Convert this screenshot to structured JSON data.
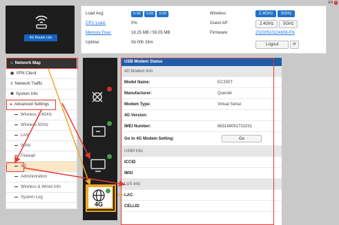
{
  "logo": {
    "text": "4G Router Lite"
  },
  "header": {
    "load_avg_label": "Load Avg:",
    "load_avg_values": [
      "0.00",
      "0.00",
      "0.00"
    ],
    "cpu_label": "CPU Load:",
    "cpu_value": "0%",
    "memory_label": "Memory Free:",
    "memory_value": "18.25 MB / 59.05 MB",
    "uptime_label": "Uptime:",
    "uptime_value": "0d 00h 26m",
    "wireless_label": "Wireless:",
    "wireless_24": "2.4GHz",
    "wireless_5": "5GHz",
    "guest_label": "Guest AP:",
    "guest_24": "2.4GHz",
    "guest_5": "5GHz",
    "firmware_label": "Firmware:",
    "firmware_value": "20230510224636-FN",
    "logout_label": "Logout",
    "lang_text": "EN"
  },
  "sidebar": {
    "items": [
      {
        "label": "Network Map"
      },
      {
        "label": "VPN Client"
      },
      {
        "label": "Network Traffic"
      },
      {
        "label": "System Info"
      },
      {
        "label": "Advanced Settings"
      },
      {
        "label": "Wireless 2.4GHz"
      },
      {
        "label": "Wireless 5GHz"
      },
      {
        "label": "LAN"
      },
      {
        "label": "WAN"
      },
      {
        "label": "Firewall"
      },
      {
        "label": "4G"
      },
      {
        "label": "Administration"
      },
      {
        "label": "Wireless & Wired Info"
      },
      {
        "label": "System Log"
      }
    ]
  },
  "modem": {
    "title": "USB Modem Status",
    "section_4g": "4G Modem Info",
    "model_name_label": "Model Name:",
    "model_name_value": "EC200T",
    "manufacturer_label": "Manufacturer:",
    "manufacturer_value": "Quectel",
    "modem_type_label": "Modem Type:",
    "modem_type_value": "Virtual Serial",
    "version_label": "4G Version:",
    "imei_label": "IMEI Number:",
    "imei_value": "863148051731031",
    "goto_label": "Go to 4G Modem Setting:",
    "go_button": "Go",
    "section_usim": "USIM Info",
    "iccid_label": "ICCID",
    "imsi_label": "IMSI",
    "section_lus": "LUS Info",
    "lac_label": "LAC",
    "cellid_label": "CELLID"
  },
  "colors": {
    "accent_blue": "#1e5ea8",
    "annotation_red": "#e53935",
    "annotation_orange": "#f0a825"
  }
}
